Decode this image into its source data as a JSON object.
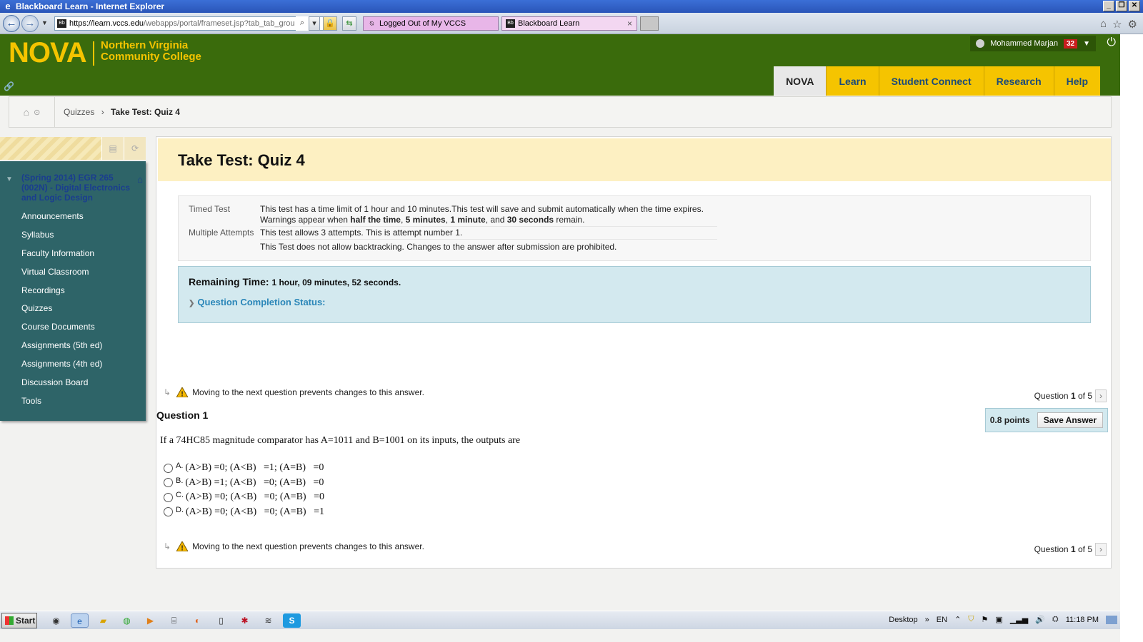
{
  "browser": {
    "window_title": "Blackboard Learn - Internet Explorer",
    "address_host": "https://learn.vccs.edu",
    "address_path": "/webapps/portal/frameset.jsp?tab_tab_grou",
    "tabs": [
      {
        "label": "Logged Out of My VCCS",
        "color": "#e8b6e8"
      },
      {
        "label": "Blackboard Learn",
        "color": "#f3d7f1"
      }
    ]
  },
  "header": {
    "logo_main": "NOVA",
    "logo_line1": "Northern Virginia",
    "logo_line2": "Community College",
    "user_name": "Mohammed Marjan",
    "notifications": "32",
    "nav_tabs": [
      "NOVA",
      "Learn",
      "Student Connect",
      "Research",
      "Help"
    ]
  },
  "breadcrumb": {
    "parent": "Quizzes",
    "separator": "›",
    "current": "Take Test: Quiz 4"
  },
  "sidebar": {
    "course": "(Spring 2014) EGR 265 (002N) - Digital Electronics and Logic Design",
    "items": [
      "Announcements",
      "Syllabus",
      "Faculty Information",
      "Virtual Classroom",
      "Recordings",
      "Quizzes",
      "Course Documents",
      "Assignments (5th ed)",
      "Assignments (4th ed)",
      "Discussion Board",
      "Tools"
    ]
  },
  "test": {
    "title": "Take Test: Quiz 4",
    "info": {
      "timed_label": "Timed Test",
      "timed_line1": "This test has a time limit of 1 hour and 10 minutes.This test will save and submit automatically when the time expires.",
      "warn_prefix": "Warnings appear when ",
      "warn_half": "half the time",
      "warn_sep1": ", ",
      "warn_5min": "5 minutes",
      "warn_sep2": ", ",
      "warn_1min": "1 minute",
      "warn_and": ", and ",
      "warn_30s": "30 seconds",
      "warn_suffix": " remain.",
      "attempts_label": "Multiple Attempts",
      "attempts_text": "This test allows 3 attempts. This is attempt number 1.",
      "backtrack_text": "This Test does not allow backtracking. Changes to the answer after submission are prohibited."
    },
    "remaining_label": "Remaining Time:",
    "remaining_value": "1 hour, 09 minutes, 52 seconds.",
    "completion_status": "Question Completion Status:",
    "warning_text": "Moving to the next question prevents changes to this answer.",
    "question_nav": {
      "prefix": "Question ",
      "current": "1",
      "of": " of 5"
    },
    "question": {
      "heading": "Question 1",
      "points": "0.8 points",
      "save_label": "Save Answer",
      "text": "If a 74HC85 magnitude comparator has A=1011 and B=1001 on its inputs, the outputs are",
      "options": [
        {
          "letter": "A.",
          "text": "(A>B) =0; (A<B)   =1; (A=B)   =0"
        },
        {
          "letter": "B.",
          "text": "(A>B) =1; (A<B)   =0; (A=B)   =0"
        },
        {
          "letter": "C.",
          "text": "(A>B) =0; (A<B)   =0; (A=B)   =0"
        },
        {
          "letter": "D.",
          "text": "(A>B) =0; (A<B)   =0; (A=B)   =1"
        }
      ]
    }
  },
  "taskbar": {
    "start": "Start",
    "desktop": "Desktop",
    "lang": "EN",
    "clock": "11:18 PM"
  },
  "colors": {
    "header_green": "#3a6b0c",
    "nav_yellow": "#f5c400",
    "sidebar_teal": "#2e6468",
    "timer_blue": "#d3e9ef"
  }
}
